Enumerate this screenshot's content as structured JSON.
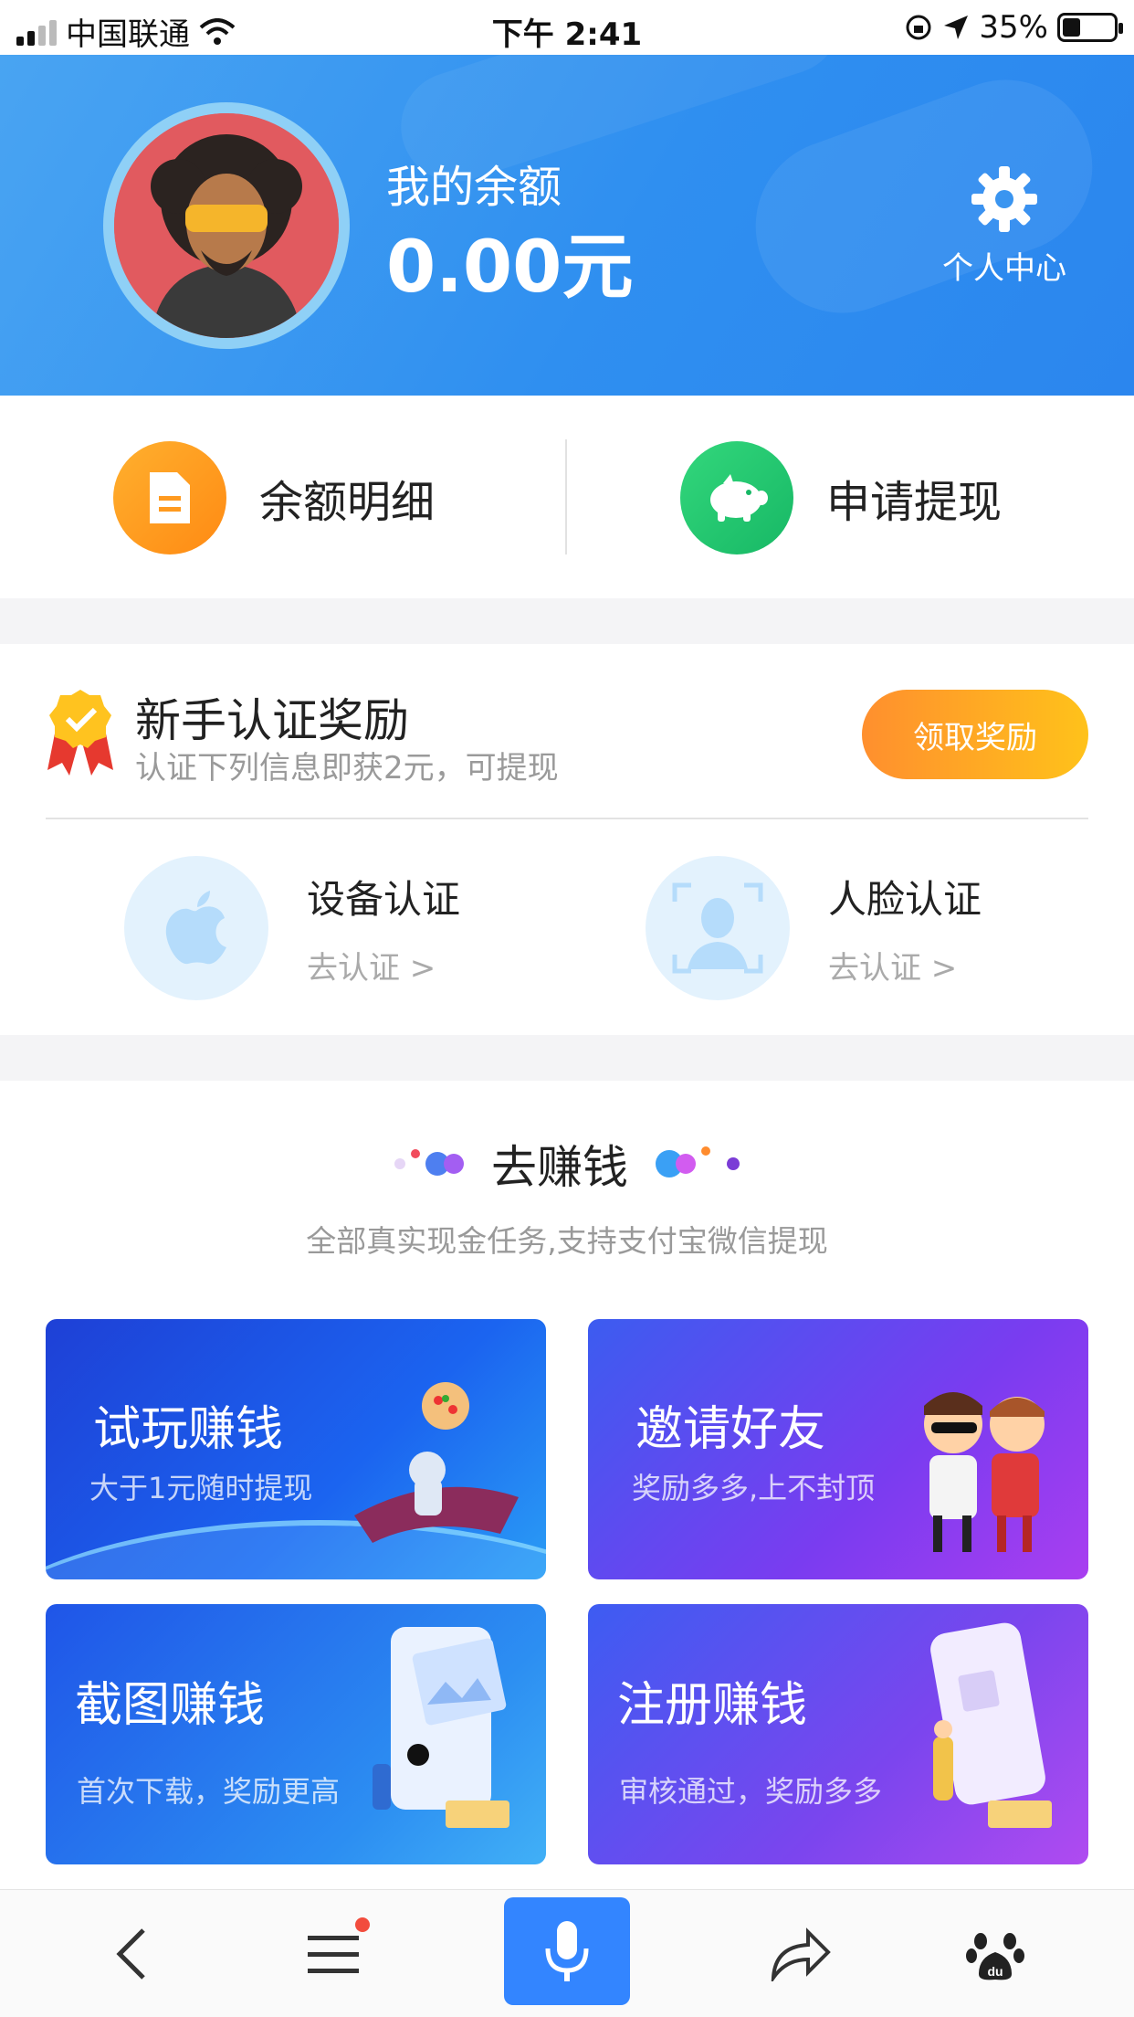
{
  "status_bar": {
    "carrier": "中国联通",
    "time": "下午 2:41",
    "battery": "35%",
    "battery_level": 0.35
  },
  "header": {
    "balance_label": "我的余额",
    "balance_value": "0.00元",
    "profile_label": "个人中心"
  },
  "quick_actions": {
    "balance_detail": "余额明细",
    "withdraw": "申请提现"
  },
  "newbie": {
    "title": "新手认证奖励",
    "subtitle": "认证下列信息即获2元，可提现",
    "claim_button": "领取奖励",
    "device": {
      "title": "设备认证",
      "action": "去认证 >"
    },
    "face": {
      "title": "人脸认证",
      "action": "去认证 >"
    }
  },
  "earn": {
    "title": "去赚钱",
    "subtitle": "全部真实现金任务,支持支付宝微信提现",
    "tiles": [
      {
        "title": "试玩赚钱",
        "subtitle": "大于1元随时提现"
      },
      {
        "title": "邀请好友",
        "subtitle": "奖励多多,上不封顶"
      },
      {
        "title": "截图赚钱",
        "subtitle": "首次下载，奖励更高"
      },
      {
        "title": "注册赚钱",
        "subtitle": "审核通过，奖励多多"
      }
    ]
  },
  "bottom_nav": [
    "back-icon",
    "menu-icon",
    "mic-icon",
    "share-icon",
    "baidu-paw-icon"
  ],
  "colors": {
    "header_blue": "#2f8ff0",
    "orange": "#ff8f2e",
    "green": "#17b865",
    "mic_blue": "#3385ff",
    "notification_red": "#f24c3d"
  }
}
